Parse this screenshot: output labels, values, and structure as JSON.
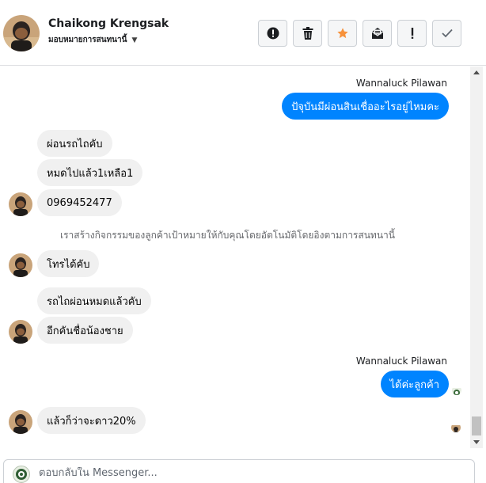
{
  "header": {
    "contact_name": "Chaikong Krengsak",
    "assign_label": "มอบหมายการสนทนานี้",
    "toolbar": [
      {
        "name": "spam-button",
        "icon": "alert-circle-icon"
      },
      {
        "name": "delete-button",
        "icon": "trash-icon"
      },
      {
        "name": "star-button",
        "icon": "star-icon",
        "color": "#f7923b"
      },
      {
        "name": "mark-unread-button",
        "icon": "envelope-icon"
      },
      {
        "name": "follow-up-button",
        "icon": "exclamation-icon"
      },
      {
        "name": "mark-done-button",
        "icon": "check-icon"
      }
    ]
  },
  "thread": {
    "messages": [
      {
        "sender": "Wannaluck Pilawan",
        "text": "ปัจุบันมีผ่อนสินเชื่ออะไรอยู่ไหมคะ",
        "direction": "out"
      },
      {
        "text": "ผ่อนรถไถคับ",
        "direction": "in"
      },
      {
        "text": "หมดไปแล้ว1เหลือ1",
        "direction": "in"
      },
      {
        "text": "0969452477",
        "direction": "in"
      },
      {
        "system_text": "เราสร้างกิจกรรมของลูกค้าเป้าหมายให้กับคุณโดยอัตโนมัติโดยอิงตามการสนทนานี้"
      },
      {
        "text": "โทรได้คับ",
        "direction": "in"
      },
      {
        "text": "รถไถผ่อนหมดแล้วคับ",
        "direction": "in"
      },
      {
        "text": "อีกคันชื่อน้องชาย",
        "direction": "in"
      },
      {
        "sender": "Wannaluck Pilawan",
        "text": "ได้ค่ะลูกค้า",
        "direction": "out"
      },
      {
        "text": "แล้วก็ว่าจะดาว20%",
        "direction": "in"
      }
    ]
  },
  "composer": {
    "placeholder": "ตอบกลับใน Messenger..."
  },
  "colors": {
    "outgoing_bubble": "#0084ff",
    "incoming_bubble": "#f0f0f0",
    "star": "#f7923b"
  }
}
